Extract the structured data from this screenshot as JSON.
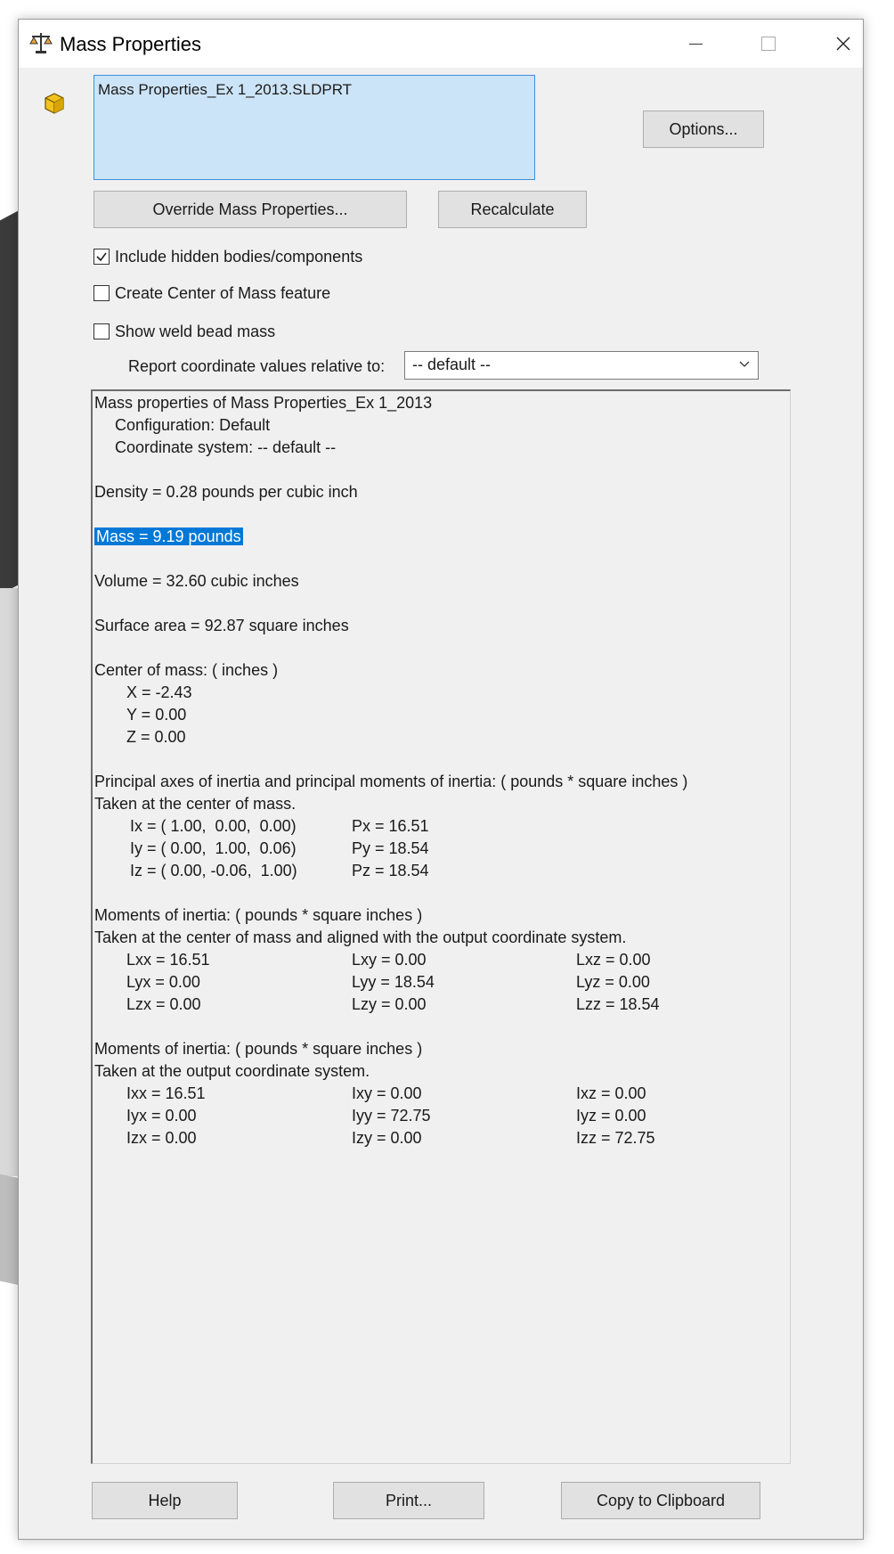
{
  "window": {
    "title": "Mass Properties",
    "icons": {
      "title": "balance-scale-icon",
      "part": "part-cube-icon"
    }
  },
  "selection": {
    "item": "Mass Properties_Ex 1_2013.SLDPRT"
  },
  "buttons": {
    "options": "Options...",
    "override": "Override Mass Properties...",
    "recalculate": "Recalculate",
    "help": "Help",
    "print": "Print...",
    "copy": "Copy to Clipboard"
  },
  "checkboxes": [
    {
      "label": "Include hidden bodies/components",
      "checked": true
    },
    {
      "label": "Create Center of Mass feature",
      "checked": false
    },
    {
      "label": "Show weld bead mass",
      "checked": false
    }
  ],
  "report": {
    "label": "Report coordinate values relative to:",
    "selected": "-- default --"
  },
  "results": {
    "header": "Mass properties of Mass Properties_Ex 1_2013",
    "configuration": "Configuration: Default",
    "coordinate_system": "Coordinate system: -- default --",
    "density": "Density = 0.28 pounds per cubic inch",
    "mass": "Mass = 9.19 pounds",
    "volume": "Volume = 32.60 cubic inches",
    "surface_area": "Surface area = 92.87 square inches",
    "com_header": "Center of mass: ( inches )",
    "com": [
      "X = -2.43",
      "Y = 0.00",
      "Z = 0.00"
    ],
    "principal_header": "Principal axes of inertia and principal moments of inertia: ( pounds * square inches )",
    "principal_taken": "Taken at the center of mass.",
    "principal_axes": [
      "Ix = ( 1.00,  0.00,  0.00)",
      "Iy = ( 0.00,  1.00,  0.06)",
      "Iz = ( 0.00, -0.06,  1.00)"
    ],
    "principal_moments": [
      "Px = 16.51",
      "Py = 18.54",
      "Pz = 18.54"
    ],
    "moi1_header": "Moments of inertia: ( pounds * square inches )",
    "moi1_taken": "Taken at the center of mass and aligned with the output coordinate system.",
    "moi1": [
      [
        "Lxx = 16.51",
        "Lxy = 0.00",
        "Lxz = 0.00"
      ],
      [
        "Lyx = 0.00",
        "Lyy = 18.54",
        "Lyz = 0.00"
      ],
      [
        "Lzx = 0.00",
        "Lzy = 0.00",
        "Lzz = 18.54"
      ]
    ],
    "moi2_header": "Moments of inertia: ( pounds * square inches )",
    "moi2_taken": "Taken at the output coordinate system.",
    "moi2": [
      [
        "Ixx = 16.51",
        "Ixy = 0.00",
        "Ixz = 0.00"
      ],
      [
        "Iyx = 0.00",
        "Iyy = 72.75",
        "Iyz = 0.00"
      ],
      [
        "Izx = 0.00",
        "Izy = 0.00",
        "Izz = 72.75"
      ]
    ]
  }
}
